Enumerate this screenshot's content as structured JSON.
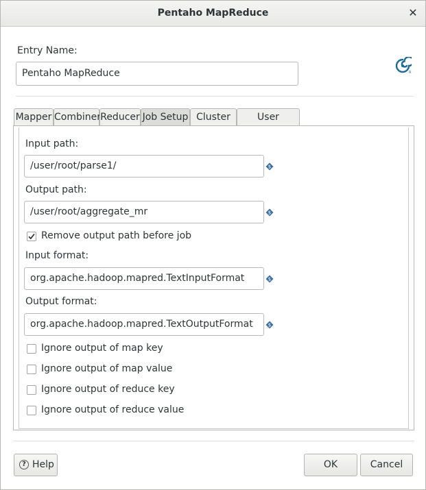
{
  "window": {
    "title": "Pentaho MapReduce",
    "close_glyph": "✕"
  },
  "entry": {
    "label": "Entry Name:",
    "value": "Pentaho MapReduce"
  },
  "logo": {
    "icon": "pentaho-spiral-icon",
    "mark": "R",
    "color": "#1b6a9a"
  },
  "tabs": [
    {
      "label": "Mapper",
      "active": false
    },
    {
      "label": "Combiner",
      "active": false
    },
    {
      "label": "Reducer",
      "active": false
    },
    {
      "label": "Job Setup",
      "active": true
    },
    {
      "label": "Cluster",
      "active": false
    },
    {
      "label": "User Defined",
      "active": false
    }
  ],
  "job_setup": {
    "input_path": {
      "label": "Input path:",
      "value": "/user/root/parse1/"
    },
    "output_path": {
      "label": "Output path:",
      "value": "/user/root/aggregate_mr"
    },
    "remove_output": {
      "label": "Remove output path before job",
      "checked": true
    },
    "input_format": {
      "label": "Input format:",
      "value": "org.apache.hadoop.mapred.TextInputFormat"
    },
    "output_format": {
      "label": "Output format:",
      "value": "org.apache.hadoop.mapred.TextOutputFormat"
    },
    "ignore_options": [
      {
        "label": "Ignore output of map key",
        "checked": false
      },
      {
        "label": "Ignore output of map value",
        "checked": false
      },
      {
        "label": "Ignore output of reduce key",
        "checked": false
      },
      {
        "label": "Ignore output of reduce value",
        "checked": false
      }
    ]
  },
  "variable_icon": {
    "name": "variable-diamond-icon",
    "color": "#3d6ea0"
  },
  "buttons": {
    "help": "Help",
    "help_icon": "?",
    "ok": "OK",
    "cancel": "Cancel"
  }
}
